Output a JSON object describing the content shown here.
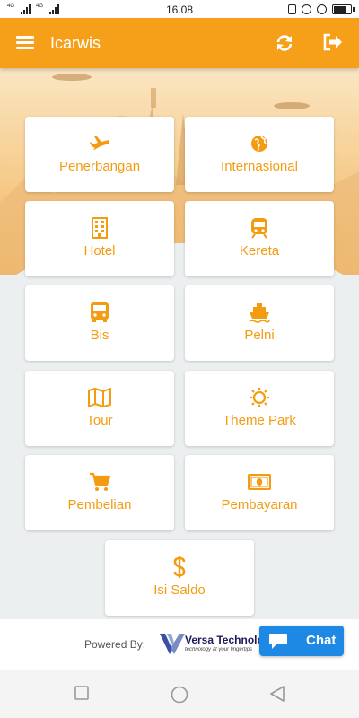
{
  "status_bar": {
    "time": "16.08",
    "sim1_tag": "4G",
    "sim2_tag": "4G",
    "battery_level": 0.85,
    "icons": [
      "signal-icon",
      "vibrate-icon",
      "at-icon",
      "alarm-icon",
      "battery-icon"
    ]
  },
  "app_bar": {
    "title": "Icarwis",
    "icons": [
      "menu-icon",
      "refresh-icon",
      "logout-icon"
    ]
  },
  "menu": [
    {
      "label": "Penerbangan",
      "icon": "airplane-icon"
    },
    {
      "label": "Internasional",
      "icon": "globe-icon"
    },
    {
      "label": "Hotel",
      "icon": "building-icon"
    },
    {
      "label": "Kereta",
      "icon": "train-icon"
    },
    {
      "label": "Bis",
      "icon": "bus-icon"
    },
    {
      "label": "Pelni",
      "icon": "ship-icon"
    },
    {
      "label": "Tour",
      "icon": "map-icon"
    },
    {
      "label": "Theme Park",
      "icon": "sun-icon"
    },
    {
      "label": "Pembelian",
      "icon": "cart-icon"
    },
    {
      "label": "Pembayaran",
      "icon": "money-icon"
    },
    {
      "label": "Isi Saldo",
      "icon": "dollar-icon"
    }
  ],
  "footer": {
    "powered_by": "Powered By:",
    "company_name": "Versa Technologies",
    "company_tagline": "technology at your fingertips"
  },
  "chat": {
    "label": "Chat"
  },
  "colors": {
    "accent": "#f6a01a",
    "icon": "#f39c12",
    "chat": "#1e88e5",
    "background": "#eceff0"
  }
}
